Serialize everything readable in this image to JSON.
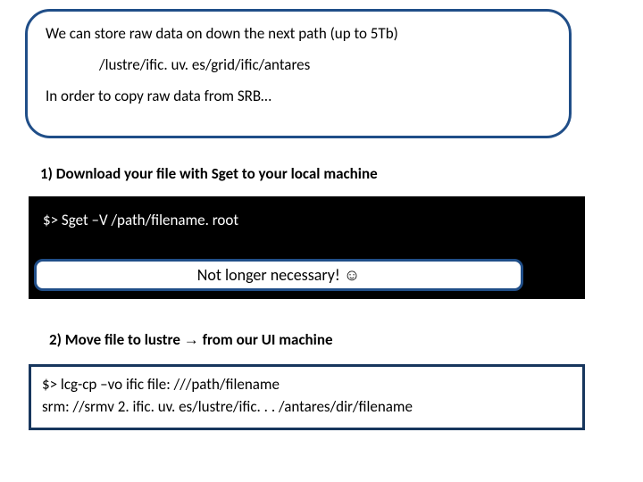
{
  "intro": {
    "line1": "We can store raw data on down the next path (up to 5Tb)",
    "path": "/lustre/ific. uv. es/grid/ific/antares",
    "line2": "In order to copy raw data from SRB…"
  },
  "steps": {
    "s1": "1) Download your file with Sget to your local machine",
    "s2_pre": "2) Move file to lustre ",
    "s2_arrow": "→",
    "s2_post": " from our UI machine"
  },
  "terminal": {
    "cmd1": "$> Sget –V /path/filename. root"
  },
  "callout": {
    "text": "Not longer necessary! ",
    "smile": "☺"
  },
  "cmd2": {
    "line1": "$> lcg-cp –vo ific file: ///path/filename",
    "line2": "srm: //srmv 2. ific. uv. es/lustre/ific. . . /antares/dir/filename"
  }
}
